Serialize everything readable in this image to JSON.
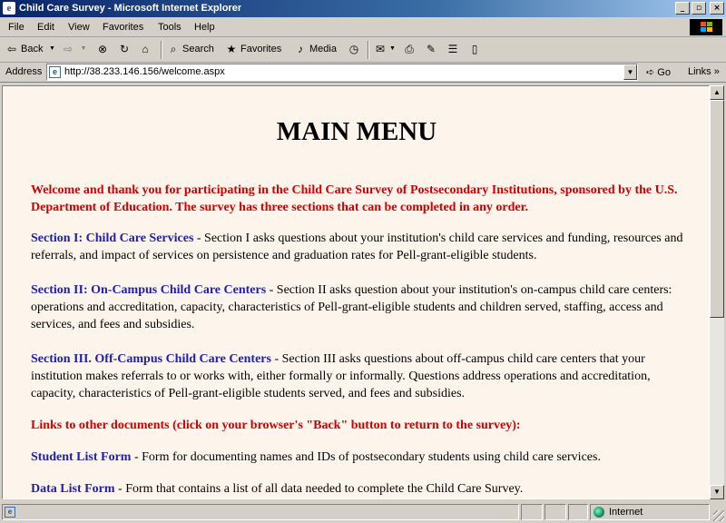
{
  "window": {
    "title": "Child Care Survey - Microsoft Internet Explorer",
    "buttons": {
      "minimize": "_",
      "maximize": "▫",
      "close": "×"
    }
  },
  "menu": {
    "items": [
      "File",
      "Edit",
      "View",
      "Favorites",
      "Tools",
      "Help"
    ]
  },
  "toolbar": {
    "back": "Back",
    "search": "Search",
    "favorites": "Favorites",
    "media": "Media"
  },
  "address": {
    "label": "Address",
    "url": "http://38.233.146.156/welcome.aspx",
    "go": "Go",
    "links": "Links"
  },
  "page": {
    "heading": "MAIN MENU",
    "welcome": "Welcome and thank you for participating in the Child Care Survey of Postsecondary Institutions, sponsored by the U.S. Department of Education. The survey has three sections that can be completed in any order.",
    "sections": [
      {
        "link": "Section I: Child Care Services",
        "desc": " - Section I asks questions about your institution's child care services and funding, resources and referrals, and impact of services on persistence and graduation rates for Pell-grant-eligible students."
      },
      {
        "link": "Section II: On-Campus Child Care Centers",
        "desc": " - Section II asks question about your institution's on-campus child care centers: operations and accreditation, capacity, characteristics of Pell-grant-eligible students and children served, staffing, access and services, and fees and subsidies."
      },
      {
        "link": "Section III. Off-Campus Child Care Centers",
        "desc": " - Section III asks questions about off-campus child care centers that your institution makes referrals to or works with, either formally or informally. Questions address operations and accreditation, capacity, characteristics of Pell-grant-eligible students served, and fees and subsidies."
      }
    ],
    "links_heading": "Links to other documents (click on your browser's \"Back\" button to return to the survey):",
    "documents": [
      {
        "link": "Student List Form",
        "desc": " - Form for documenting names and IDs of postsecondary students using child care services."
      },
      {
        "link": "Data List Form",
        "desc": " - Form that contains a list of all data needed to complete the Child Care Survey."
      }
    ]
  },
  "status": {
    "zone": "Internet"
  },
  "colors": {
    "page_background": "#fdf5ec",
    "emphasis_red": "#d00000",
    "link_blue": "#2020b0"
  }
}
